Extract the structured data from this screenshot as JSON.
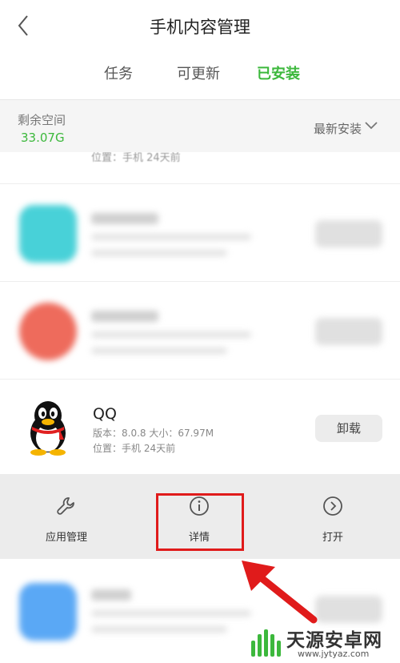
{
  "header": {
    "title": "手机内容管理"
  },
  "tabs": [
    {
      "label": "任务",
      "active": false
    },
    {
      "label": "可更新",
      "active": false
    },
    {
      "label": "已安装",
      "active": true
    }
  ],
  "storage": {
    "label": "剩余空间",
    "value": "33.07G"
  },
  "sort": {
    "label": "最新安装"
  },
  "partial_row": {
    "meta": "位置：手机    24天前"
  },
  "apps_blurred": [
    {
      "icon_color": "#48d1d8"
    },
    {
      "icon_color": "#ee6b5c"
    }
  ],
  "qq_app": {
    "name": "QQ",
    "version_line": "版本：8.0.8    大小：67.97M",
    "location_line": "位置：手机    24天前",
    "uninstall_label": "卸载"
  },
  "actions": [
    {
      "label": "应用管理",
      "icon": "wrench-icon"
    },
    {
      "label": "详情",
      "icon": "info-icon"
    },
    {
      "label": "打开",
      "icon": "chevron-right-circle-icon"
    }
  ],
  "bottom_app": {
    "icon_color": "#5aa8f5"
  },
  "watermark": {
    "text": "天源安卓网",
    "url": "www.jytyaz.com"
  },
  "colors": {
    "accent": "#3cb83c",
    "highlight": "#e01b1b"
  }
}
